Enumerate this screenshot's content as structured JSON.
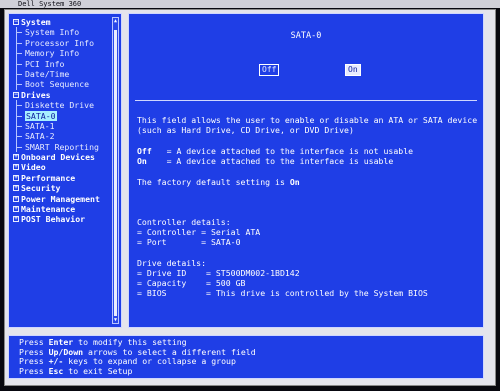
{
  "window": {
    "title": "Dell System 360"
  },
  "tree": [
    {
      "label": "System",
      "level": 0,
      "expander": "−"
    },
    {
      "label": "System Info",
      "level": 1
    },
    {
      "label": "Processor Info",
      "level": 1
    },
    {
      "label": "Memory Info",
      "level": 1
    },
    {
      "label": "PCI Info",
      "level": 1
    },
    {
      "label": "Date/Time",
      "level": 1
    },
    {
      "label": "Boot Sequence",
      "level": 1
    },
    {
      "label": "Drives",
      "level": 0,
      "expander": "−"
    },
    {
      "label": "Diskette Drive",
      "level": 1
    },
    {
      "label": "SATA-0",
      "level": 1,
      "selected": true
    },
    {
      "label": "SATA-1",
      "level": 1
    },
    {
      "label": "SATA-2",
      "level": 1
    },
    {
      "label": "SMART Reporting",
      "level": 1
    },
    {
      "label": "Onboard Devices",
      "level": 0,
      "expander": "+"
    },
    {
      "label": "Video",
      "level": 0,
      "expander": "+"
    },
    {
      "label": "Performance",
      "level": 0,
      "expander": "+"
    },
    {
      "label": "Security",
      "level": 0,
      "expander": "+"
    },
    {
      "label": "Power Management",
      "level": 0,
      "expander": "+"
    },
    {
      "label": "Maintenance",
      "level": 0,
      "expander": "+"
    },
    {
      "label": "POST Behavior",
      "level": 0,
      "expander": "+"
    }
  ],
  "main": {
    "field_title": "SATA-0",
    "option_off": "Off",
    "option_on": "On",
    "help": {
      "line1": "This field allows the user to enable or disable an ATA or SATA device",
      "line2": "(such as Hard Drive, CD Drive, or DVD Drive)",
      "off_key": "Off",
      "off_desc": "   = A device attached to the interface is not usable",
      "on_key": "On",
      "on_desc": "    = A device attached to the interface is usable",
      "default_prefix": "The factory default setting is ",
      "default_value": "On"
    },
    "controller": {
      "header": "Controller details:",
      "controller_line": "= Controller = Serial ATA",
      "port_line": "= Port       = SATA-0"
    },
    "drive": {
      "header": "Drive details:",
      "id_line": "= Drive ID    = ST500DM002-1BD142",
      "capacity_line": "= Capacity    = 500 GB",
      "bios_line": "= BIOS        = This drive is controlled by the System BIOS"
    }
  },
  "footer": {
    "l1_pre": "Press ",
    "l1_key": "Enter",
    "l1_post": " to modify this setting",
    "l2_pre": "Press ",
    "l2_key": "Up/Down",
    "l2_post": " arrows to select a different field",
    "l3_pre": "Press ",
    "l3_key": "+/-",
    "l3_post": " keys to expand or collapse a group",
    "l4_pre": "Press ",
    "l4_key": "Esc",
    "l4_post": " to exit Setup"
  },
  "colors": {
    "panel": "#1f3ee6",
    "highlight": "#a8f0ff",
    "text": "#ffffff"
  }
}
